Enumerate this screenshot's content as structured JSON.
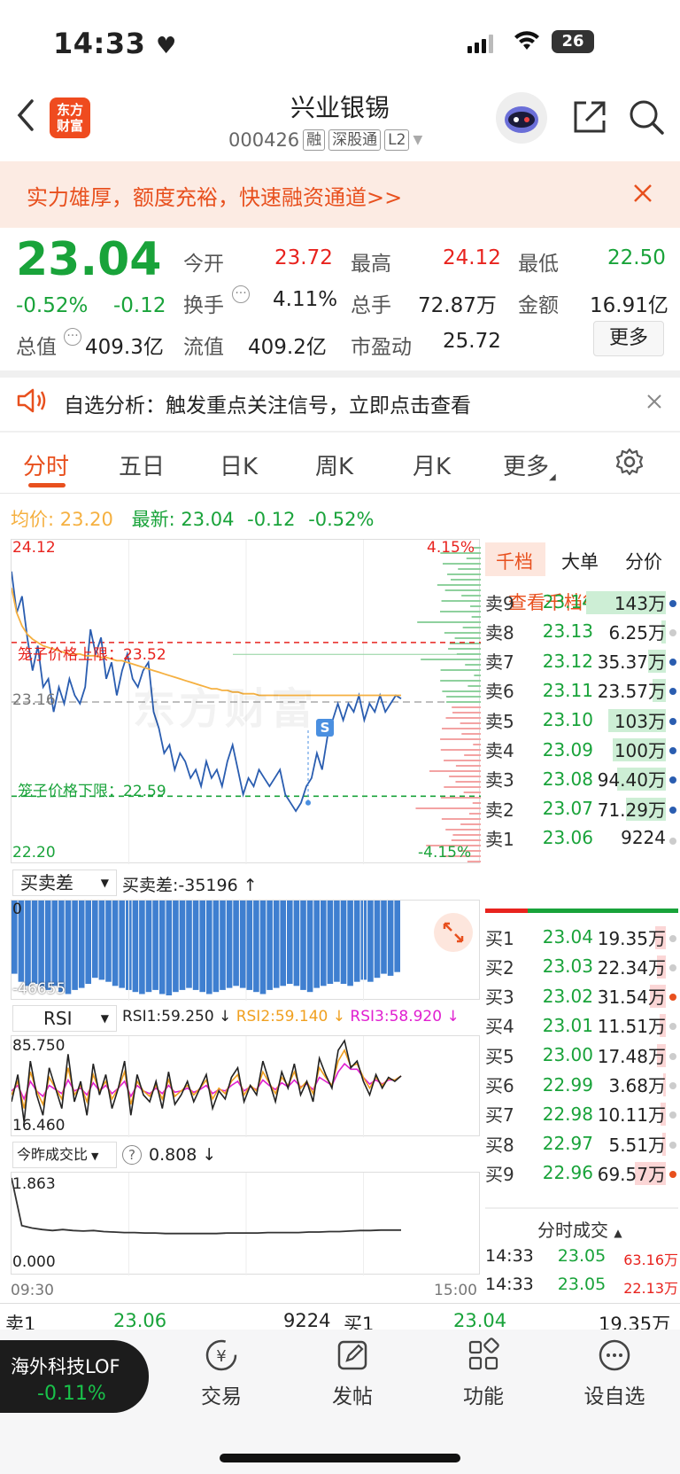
{
  "status_bar": {
    "time": "14:33",
    "battery": "26"
  },
  "header": {
    "logo": "东方财富",
    "title": "兴业银锡",
    "code": "000426",
    "tags": [
      "融",
      "深股通",
      "L2"
    ]
  },
  "banner": {
    "text": "实力雄厚，额度充裕，快速融资通道>>"
  },
  "quote": {
    "price": "23.04",
    "change_pct": "-0.52%",
    "change": "-0.12",
    "fields": [
      {
        "label": "今开",
        "value": "23.72",
        "color": "red"
      },
      {
        "label": "最高",
        "value": "24.12",
        "color": "red"
      },
      {
        "label": "最低",
        "value": "22.50",
        "color": "green"
      },
      {
        "label": "换手",
        "value": "4.11%",
        "color": "black"
      },
      {
        "label": "总手",
        "value": "72.87万",
        "color": "black"
      },
      {
        "label": "金额",
        "value": "16.91亿",
        "color": "black"
      },
      {
        "label": "总值",
        "value": "409.3亿",
        "color": "black"
      },
      {
        "label": "流值",
        "value": "409.2亿",
        "color": "black"
      },
      {
        "label": "市盈动",
        "value": "25.72",
        "color": "black"
      }
    ],
    "more_label": "更多"
  },
  "alert": {
    "text": "自选分析：触发重点关注信号，立即点击查看"
  },
  "tabs": [
    "分时",
    "五日",
    "日K",
    "周K",
    "月K",
    "更多"
  ],
  "active_tab": 0,
  "info_row": {
    "avg_label": "均价:",
    "avg_value": "23.20",
    "latest_label": "最新:",
    "latest_value": "23.04",
    "change": "-0.12",
    "change_pct": "-0.52%"
  },
  "chart_data": [
    {
      "type": "line",
      "title": "分时",
      "y_labels": {
        "top": "24.12",
        "mid": "23.16",
        "bottom": "22.20",
        "top_pct": "4.15%",
        "bottom_pct": "-4.15%"
      },
      "ylim": [
        22.2,
        24.12
      ],
      "x_ticks": [
        "09:30",
        "15:00"
      ],
      "upper_limit_label": "笼子价格上限：23.52",
      "upper_limit": 23.52,
      "lower_limit_label": "笼子价格下限：22.59",
      "lower_limit": 22.59,
      "marker": "S",
      "series": [
        {
          "name": "price",
          "color": "#2a5db0",
          "values": [
            23.95,
            23.7,
            23.8,
            23.55,
            23.35,
            23.5,
            23.25,
            23.3,
            23.1,
            23.25,
            23.15,
            23.3,
            23.2,
            23.15,
            23.25,
            23.6,
            23.45,
            23.55,
            23.3,
            23.4,
            23.2,
            23.35,
            23.45,
            23.3,
            23.25,
            23.35,
            23.4,
            23.1,
            23.0,
            22.85,
            22.9,
            22.75,
            22.85,
            22.8,
            22.7,
            22.75,
            22.65,
            22.8,
            22.7,
            22.75,
            22.65,
            22.8,
            22.9,
            22.75,
            22.6,
            22.7,
            22.65,
            22.75,
            22.7,
            22.65,
            22.7,
            22.75,
            22.6,
            22.55,
            22.5,
            22.55,
            22.65,
            22.7,
            22.85,
            22.75,
            22.95,
            23.05,
            23.15,
            23.05,
            23.15,
            23.1,
            23.2,
            23.05,
            23.15,
            23.1,
            23.2,
            23.1,
            23.15,
            23.2,
            23.18
          ]
        },
        {
          "name": "均价",
          "color": "#f5b040",
          "values": [
            23.85,
            23.7,
            23.62,
            23.57,
            23.54,
            23.52,
            23.5,
            23.49,
            23.48,
            23.47,
            23.46,
            23.45,
            23.45,
            23.45,
            23.44,
            23.44,
            23.44,
            23.43,
            23.43,
            23.42,
            23.41,
            23.41,
            23.4,
            23.39,
            23.38,
            23.37,
            23.36,
            23.35,
            23.34,
            23.33,
            23.32,
            23.31,
            23.3,
            23.29,
            23.28,
            23.27,
            23.26,
            23.25,
            23.24,
            23.24,
            23.23,
            23.23,
            23.22,
            23.22,
            23.21,
            23.21,
            23.21,
            23.2,
            23.2,
            23.2,
            23.2,
            23.2,
            23.2,
            23.2,
            23.2,
            23.2,
            23.2,
            23.2,
            23.2,
            23.2,
            23.2,
            23.2,
            23.2,
            23.2,
            23.2,
            23.2,
            23.2,
            23.2,
            23.2,
            23.2,
            23.2,
            23.2,
            23.2,
            23.2,
            23.2
          ]
        }
      ]
    },
    {
      "type": "bar",
      "title": "买卖差",
      "label": "买卖差:-35196 ↑",
      "y_labels": {
        "top": "0",
        "bottom": "-46655"
      },
      "ylim": [
        -46655,
        0
      ],
      "values": [
        -36000,
        -40000,
        -42000,
        -41000,
        -43000,
        -44000,
        -42000,
        -45000,
        -46000,
        -44000,
        -43000,
        -41000,
        -38000,
        -39000,
        -40000,
        -42000,
        -43000,
        -44000,
        -45000,
        -46000,
        -45000,
        -44000,
        -46000,
        -46655,
        -45000,
        -44000,
        -43000,
        -44000,
        -45000,
        -46000,
        -45000,
        -44000,
        -43000,
        -42000,
        -43000,
        -44000,
        -45000,
        -46000,
        -44000,
        -43000,
        -42000,
        -41000,
        -42000,
        -44000,
        -45000,
        -43000,
        -42000,
        -41000,
        -40000,
        -41000,
        -42000,
        -40000,
        -39000,
        -40000,
        -38000,
        -36000,
        -37000,
        -35196
      ]
    },
    {
      "type": "line",
      "title": "RSI",
      "y_labels": {
        "top": "85.750",
        "bottom": "16.460"
      },
      "ylim": [
        16.46,
        85.75
      ],
      "series": [
        {
          "name": "RSI1:59.250 ↓",
          "color": "#222222",
          "values": [
            40,
            60,
            25,
            70,
            45,
            30,
            65,
            50,
            35,
            75,
            40,
            55,
            30,
            68,
            45,
            60,
            35,
            50,
            70,
            30,
            60,
            45,
            40,
            55,
            35,
            62,
            38,
            45,
            55,
            40,
            50,
            60,
            35,
            48,
            42,
            58,
            65,
            40,
            52,
            45,
            70,
            55,
            40,
            62,
            50,
            68,
            45,
            55,
            40,
            72,
            60,
            50,
            78,
            85,
            65,
            70,
            55,
            45,
            60,
            50,
            58,
            55,
            59
          ]
        },
        {
          "name": "RSI2:59.140 ↓",
          "color": "#f0a020",
          "values": [
            45,
            55,
            35,
            62,
            48,
            38,
            58,
            50,
            42,
            65,
            45,
            52,
            40,
            60,
            48,
            55,
            42,
            50,
            62,
            38,
            55,
            48,
            44,
            52,
            42,
            56,
            44,
            48,
            52,
            45,
            50,
            56,
            42,
            50,
            46,
            55,
            60,
            45,
            52,
            48,
            62,
            54,
            46,
            58,
            52,
            62,
            50,
            55,
            46,
            65,
            58,
            52,
            70,
            78,
            66,
            68,
            58,
            50,
            58,
            52,
            57,
            56,
            59
          ]
        },
        {
          "name": "RSI3:58.920 ↓",
          "color": "#e020d0",
          "values": [
            48,
            52,
            42,
            55,
            48,
            44,
            52,
            49,
            46,
            56,
            48,
            50,
            45,
            54,
            48,
            52,
            46,
            50,
            55,
            44,
            52,
            48,
            46,
            50,
            46,
            52,
            47,
            48,
            50,
            47,
            49,
            52,
            46,
            49,
            48,
            52,
            55,
            48,
            51,
            49,
            56,
            52,
            49,
            54,
            51,
            56,
            51,
            53,
            49,
            58,
            55,
            52,
            62,
            68,
            64,
            64,
            58,
            53,
            56,
            53,
            56,
            56,
            58.9
          ]
        }
      ]
    },
    {
      "type": "line",
      "title": "今昨成交比",
      "label": "0.808 ↓",
      "y_labels": {
        "top": "1.863",
        "bottom": "0.000"
      },
      "ylim": [
        0,
        1.863
      ],
      "series": [
        {
          "name": "今昨成交比",
          "color": "#333333",
          "values": [
            1.863,
            0.9,
            0.85,
            0.82,
            0.8,
            0.82,
            0.8,
            0.79,
            0.8,
            0.78,
            0.77,
            0.76,
            0.76,
            0.75,
            0.75,
            0.74,
            0.74,
            0.74,
            0.74,
            0.74,
            0.74,
            0.75,
            0.75,
            0.75,
            0.75,
            0.76,
            0.76,
            0.76,
            0.76,
            0.77,
            0.77,
            0.78,
            0.78,
            0.79,
            0.8,
            0.8,
            0.81,
            0.81,
            0.81
          ]
        }
      ]
    }
  ],
  "watermark": "东方财富",
  "orderbook": {
    "tabs": [
      "千档",
      "大单",
      "分价"
    ],
    "link": "查看千档行情 >",
    "sells": [
      {
        "label": "卖9",
        "price": "23.14",
        "vol": "143万",
        "bar": 0.9,
        "dot": "#2a5db0"
      },
      {
        "label": "卖8",
        "price": "23.13",
        "vol": "6.25万",
        "bar": 0.05,
        "dot": "#ccc"
      },
      {
        "label": "卖7",
        "price": "23.12",
        "vol": "35.37万",
        "bar": 0.2,
        "dot": "#2a5db0"
      },
      {
        "label": "卖6",
        "price": "23.11",
        "vol": "23.57万",
        "bar": 0.15,
        "dot": "#2a5db0"
      },
      {
        "label": "卖5",
        "price": "23.10",
        "vol": "103万",
        "bar": 0.65,
        "dot": "#2a5db0"
      },
      {
        "label": "卖4",
        "price": "23.09",
        "vol": "100万",
        "bar": 0.6,
        "dot": "#2a5db0"
      },
      {
        "label": "卖3",
        "price": "23.08",
        "vol": "94.40万",
        "bar": 0.55,
        "dot": "#2a5db0"
      },
      {
        "label": "卖2",
        "price": "23.07",
        "vol": "71.29万",
        "bar": 0.45,
        "dot": "#2a5db0"
      },
      {
        "label": "卖1",
        "price": "23.06",
        "vol": "9224",
        "bar": 0.0,
        "dot": "#ccc"
      }
    ],
    "buys": [
      {
        "label": "买1",
        "price": "23.04",
        "vol": "19.35万",
        "bar": 0.12,
        "dot": "#ccc"
      },
      {
        "label": "买2",
        "price": "23.03",
        "vol": "22.34万",
        "bar": 0.1,
        "dot": "#ccc"
      },
      {
        "label": "买3",
        "price": "23.02",
        "vol": "31.54万",
        "bar": 0.18,
        "dot": "#e8501e"
      },
      {
        "label": "买4",
        "price": "23.01",
        "vol": "11.51万",
        "bar": 0.07,
        "dot": "#ccc"
      },
      {
        "label": "买5",
        "price": "23.00",
        "vol": "17.48万",
        "bar": 0.1,
        "dot": "#ccc"
      },
      {
        "label": "买6",
        "price": "22.99",
        "vol": "3.68万",
        "bar": 0.03,
        "dot": "#ccc"
      },
      {
        "label": "买7",
        "price": "22.98",
        "vol": "10.11万",
        "bar": 0.06,
        "dot": "#ccc"
      },
      {
        "label": "买8",
        "price": "22.97",
        "vol": "5.51万",
        "bar": 0.04,
        "dot": "#ccc"
      },
      {
        "label": "买9",
        "price": "22.96",
        "vol": "69.57万",
        "bar": 0.35,
        "dot": "#e8501e"
      }
    ],
    "trades_title": "分时成交",
    "trades": [
      {
        "time": "14:33",
        "price": "23.05",
        "vol": "63.16万"
      },
      {
        "time": "14:33",
        "price": "23.05",
        "vol": "22.13万"
      }
    ]
  },
  "bottom_quote": {
    "sell_label": "卖1",
    "sell_price": "23.06",
    "sell_vol": "9224",
    "buy_label": "买1",
    "buy_price": "23.04",
    "buy_vol": "19.35万"
  },
  "float_widget": {
    "name": "海外科技LOF",
    "pct": "-0.11%"
  },
  "nav": [
    {
      "label": "交易",
      "icon": "trade-icon"
    },
    {
      "label": "发帖",
      "icon": "post-icon"
    },
    {
      "label": "功能",
      "icon": "apps-icon"
    },
    {
      "label": "设自选",
      "icon": "more-dots-icon"
    }
  ],
  "colors": {
    "up": "#e8231e",
    "down": "#19a33a",
    "accent": "#e8501e",
    "price_line": "#2a5db0",
    "avg_line": "#f5b040"
  }
}
